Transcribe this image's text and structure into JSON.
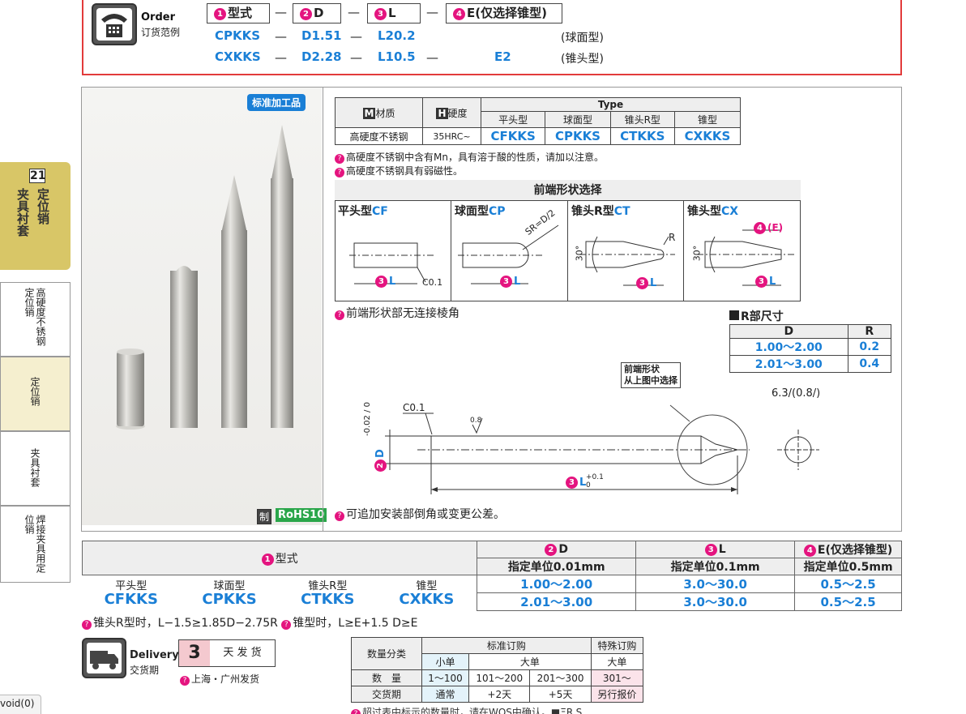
{
  "order": {
    "title": "Order",
    "subtitle": "订货范例",
    "headers": [
      {
        "num": "1",
        "label": "型式"
      },
      {
        "num": "2",
        "label": "D"
      },
      {
        "num": "3",
        "label": "L"
      },
      {
        "num": "4",
        "label": "E(仅选择锥型)"
      }
    ],
    "dash": "—",
    "rows": [
      {
        "type": "CPKKS",
        "d": "D1.51",
        "l": "L20.2",
        "e": "",
        "note": "(球面型)"
      },
      {
        "type": "CXKKS",
        "d": "D2.28",
        "l": "L10.5",
        "e": "E2",
        "note": "(锥头型)"
      }
    ]
  },
  "side_tab": {
    "page": "21",
    "title_lines": [
      "定位销",
      "夹具衬套"
    ],
    "items": [
      "高硬度不锈钢定位销",
      "定位销",
      "夹具衬套",
      "焊接夹具用定位销"
    ]
  },
  "photo": {
    "badge": "标准加工品",
    "zhi": "制",
    "rohs": "RoHS10"
  },
  "material_table": {
    "h_material_icon": "M",
    "h_material": "材质",
    "h_hardness_icon": "H",
    "h_hardness": "硬度",
    "h_type": "Type",
    "type_names": [
      "平头型",
      "球面型",
      "锥头R型",
      "锥型"
    ],
    "material": "高硬度不锈钢",
    "hardness": "35HRC~",
    "codes": [
      "CFKKS",
      "CPKKS",
      "CTKKS",
      "CXKKS"
    ],
    "notes": [
      "高硬度不锈钢中含有Mn，具有溶于酸的性质，请加以注意。",
      "高硬度不锈钢具有弱磁性。"
    ]
  },
  "shapes": {
    "title": "前端形状选择",
    "items": [
      {
        "name": "平头型",
        "code": "CF"
      },
      {
        "name": "球面型",
        "code": "CP"
      },
      {
        "name": "锥头R型",
        "code": "CT"
      },
      {
        "name": "锥头型",
        "code": "CX"
      }
    ],
    "note": "前端形状部无连接棱角",
    "labels": {
      "l": "L",
      "c01": "C0.1",
      "sr": "SR=D/2",
      "r": "R",
      "deg": "30°",
      "e": "(E)"
    }
  },
  "r_table": {
    "title": "R部尺寸",
    "headers": [
      "D",
      "R"
    ],
    "rows": [
      [
        "1.00～2.00",
        "0.2"
      ],
      [
        "2.01～3.00",
        "0.4"
      ]
    ]
  },
  "drawing": {
    "shape_label_1": "前端形状",
    "shape_label_2": "从上图中选择",
    "c01": "C0.1",
    "rough": "0.8",
    "roughness": "6.3/(0.8/)",
    "tol_d_top": "0",
    "tol_d_bottom": "-0.02",
    "d_label": "D",
    "l_label": "L",
    "tol_l_top": "+0.1",
    "tol_l_bottom": "0",
    "note": "可追加安装部倒角或变更公差。"
  },
  "bottom_table": {
    "col1": "型式",
    "col2": "D",
    "col2_sub": "指定单位0.01mm",
    "col3": "L",
    "col3_sub": "指定单位0.1mm",
    "col4": "E(仅选择锥型)",
    "col4_sub": "指定单位0.5mm",
    "type_names": [
      "平头型",
      "球面型",
      "锥头R型",
      "锥型"
    ],
    "codes": [
      "CFKKS",
      "CPKKS",
      "CTKKS",
      "CXKKS"
    ],
    "rows": [
      [
        "1.00～2.00",
        "3.0～30.0",
        "0.5～2.5"
      ],
      [
        "2.01～3.00",
        "3.0～30.0",
        "0.5～2.5"
      ]
    ],
    "note_a": "锥头R型时，L−1.5≥1.85D−2.75R",
    "note_b": "锥型时，L≥E+1.5 D≥E"
  },
  "delivery": {
    "title": "Delivery",
    "subtitle": "交货期",
    "days": "3",
    "days_label": "天 发 货",
    "ship_note": "上海・广州发货",
    "table": {
      "h_qty": "数量分类",
      "h_std": "标准订购",
      "h_special": "特殊订购",
      "h_small": "小单",
      "h_large": "大单",
      "h_large2": "大单",
      "row1_label": "数　量",
      "row1": [
        "1～100",
        "101～200",
        "201～300",
        "301～"
      ],
      "row2_label": "交货期",
      "row2": [
        "通常",
        "+2天",
        "+5天",
        "另行报价"
      ]
    },
    "cut_text": "超过表中标示的数量时，请在WOS中确认。■ΞR.S"
  },
  "status": {
    "text": "void(0)"
  }
}
